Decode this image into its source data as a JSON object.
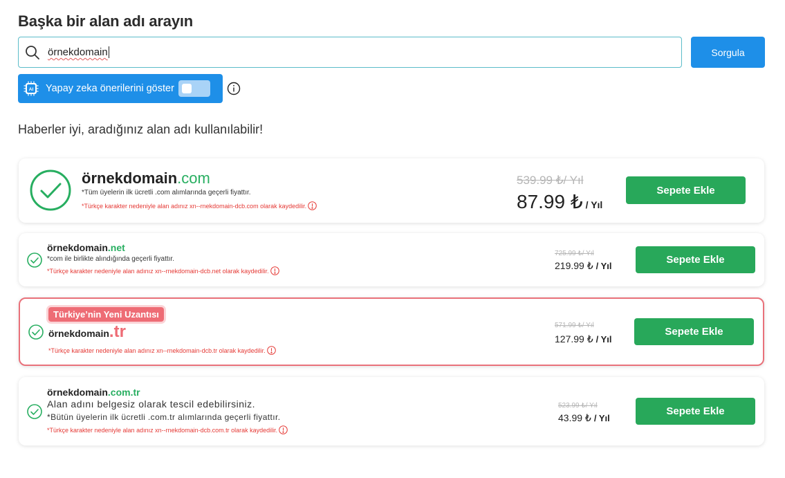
{
  "heading": "Başka bir alan adı arayın",
  "search": {
    "value": "örnekdomain",
    "button_label": "Sorgula"
  },
  "ai_toggle": {
    "label": "Yapay zeka önerilerini göster",
    "chip_text": "AI",
    "enabled": false
  },
  "result_message": "Haberler iyi, aradığınız alan adı kullanılabilir!",
  "results": [
    {
      "name": "örnekdomain",
      "tld": ".com",
      "note": "*Tüm üyelerin ilk ücretli .com alımlarında geçerli fiyattır.",
      "warning": "*Türkçe karakter nedeniyle alan adınız xn--rnekdomain-dcb.com olarak kaydedilir.",
      "old_price": "539.99 ₺/ Yıl",
      "price": "87.99 ₺",
      "per": "/ Yıl",
      "button": "Sepete Ekle"
    },
    {
      "name": "örnekdomain",
      "tld": ".net",
      "note": "*com ile birlikte alındığında geçerli fiyattır.",
      "warning": "*Türkçe karakter nedeniyle alan adınız xn--rnekdomain-dcb.net olarak kaydedilir.",
      "old_price": "725.99 ₺/ Yıl",
      "price": "219.99 ₺",
      "per": "/ Yıl",
      "button": "Sepete Ekle"
    },
    {
      "badge": "Türkiye’nin Yeni Uzantısı",
      "name": "örnekdomain",
      "tld": ".tr",
      "warning": "*Türkçe karakter nedeniyle alan adınız xn--rnekdomain-dcb.tr olarak kaydedilir.",
      "old_price": "571.99 ₺/ Yıl",
      "price": "127.99 ₺",
      "per": "/ Yıl",
      "button": "Sepete Ekle"
    },
    {
      "name": "örnekdomain",
      "tld": ".com.tr",
      "note_line1": "Alan adını belgesiz olarak tescil edebilirsiniz.",
      "note_line2": "*Bütün üyelerin ilk ücretli .com.tr alımlarında geçerli fiyattır.",
      "warning": "*Türkçe karakter nedeniyle alan adınız xn--rnekdomain-dcb.com.tr olarak kaydedilir.",
      "old_price": "523.99 ₺/ Yıl",
      "price": "43.99 ₺",
      "per": "/ Yıl",
      "button": "Sepete Ekle"
    }
  ],
  "colors": {
    "primary_blue": "#1e8fe8",
    "green": "#28a85a",
    "tld_green": "#27ae60",
    "warning_red": "#e53935",
    "featured_border": "#e9717a"
  }
}
